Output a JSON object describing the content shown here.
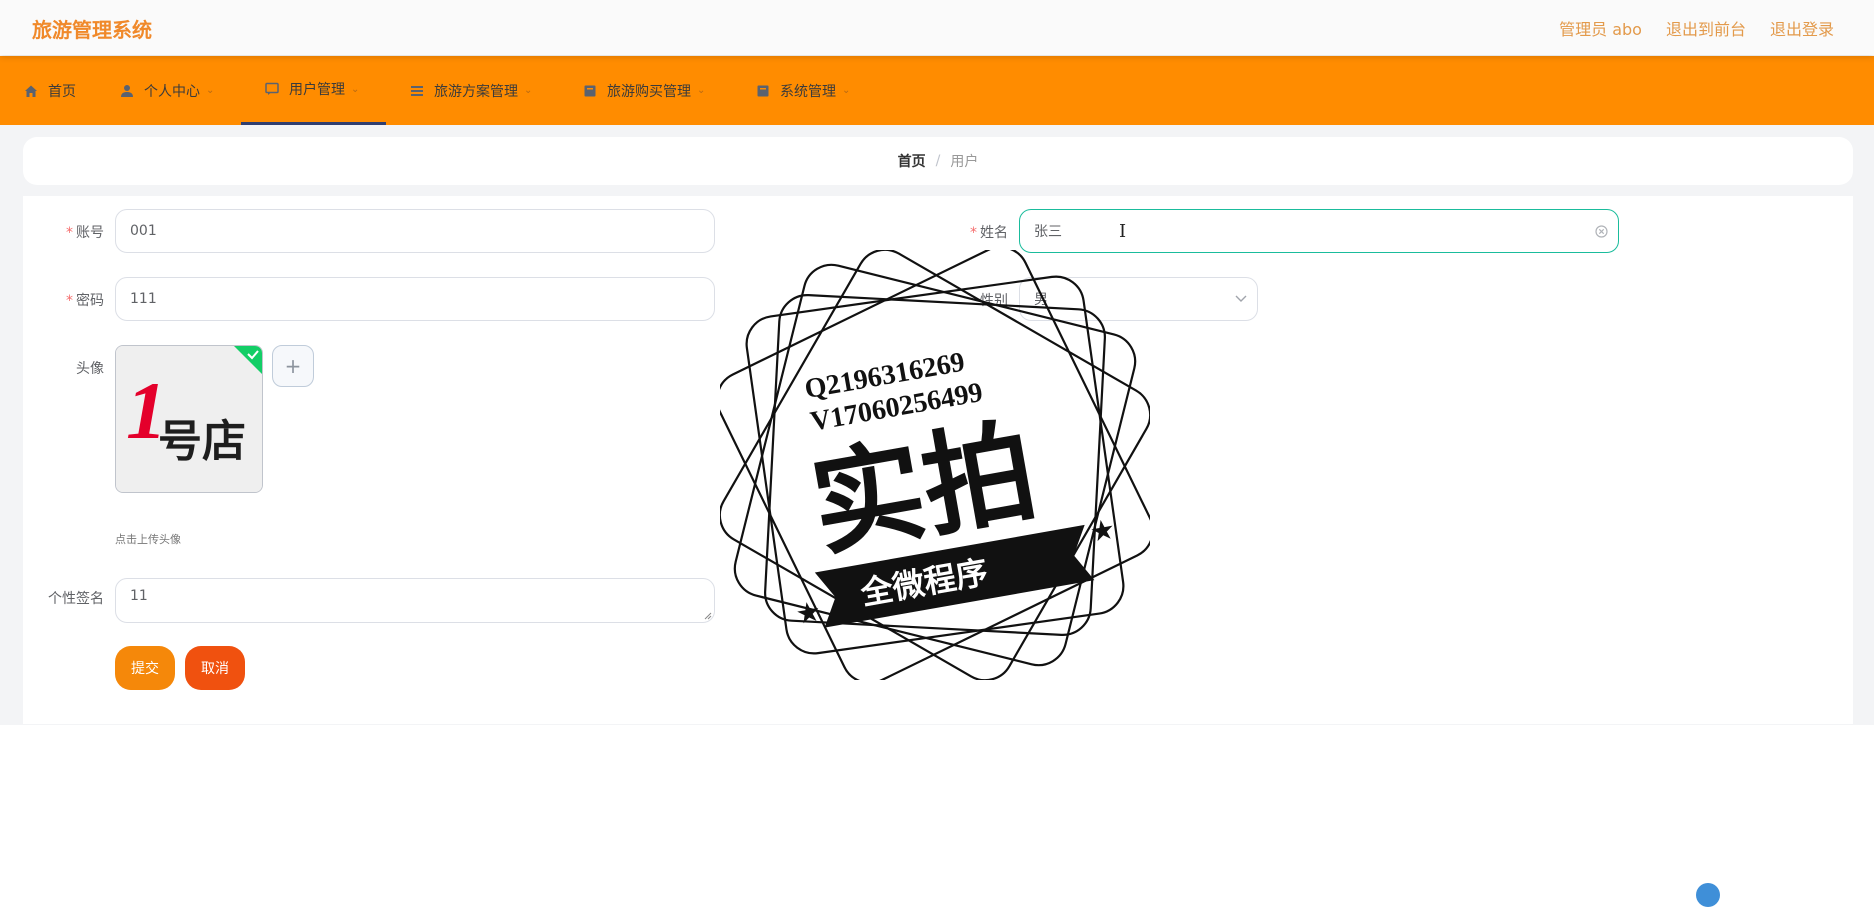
{
  "header": {
    "title": "旅游管理系统",
    "admin_label": "管理员 abo",
    "to_front_label": "退出到前台",
    "logout_label": "退出登录"
  },
  "nav": {
    "items": [
      {
        "label": "首页",
        "icon": "home-icon"
      },
      {
        "label": "个人中心",
        "icon": "user-icon"
      },
      {
        "label": "用户管理",
        "icon": "chat-icon",
        "active": true
      },
      {
        "label": "旅游方案管理",
        "icon": "list-icon"
      },
      {
        "label": "旅游购买管理",
        "icon": "box-icon"
      },
      {
        "label": "系统管理",
        "icon": "box-icon"
      }
    ]
  },
  "breadcrumb": {
    "home": "首页",
    "sep": "/",
    "current": "用户"
  },
  "form": {
    "account_label": "账号",
    "account_value": "001",
    "name_label": "姓名",
    "name_value": "张三",
    "password_label": "密码",
    "password_value": "111",
    "gender_label": "性别",
    "gender_value": "男",
    "avatar_label": "头像",
    "avatar_image_text": "1号店",
    "avatar_hint": "点击上传头像",
    "signature_label": "个性签名",
    "signature_value": "11",
    "submit_label": "提交",
    "cancel_label": "取消"
  },
  "watermark": {
    "line1": "Q2196316269",
    "line2": "V17060256499",
    "main": "实拍",
    "ribbon": "全微程序"
  },
  "colors": {
    "brand_orange": "#ff8c00",
    "title_orange": "#f0892a",
    "submit": "#f5880a",
    "cancel": "#f0510f",
    "focus_border": "#1abc9c"
  }
}
